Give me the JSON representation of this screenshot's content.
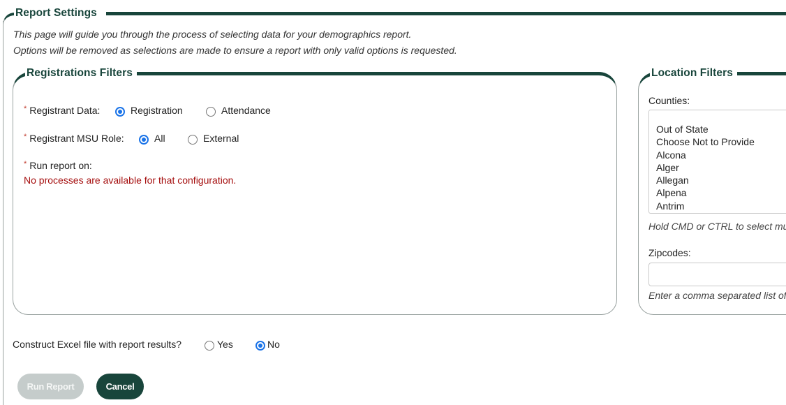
{
  "report_settings": {
    "legend": "Report Settings",
    "intro_line1": "This page will guide you through the process of selecting data for your demographics report.",
    "intro_line2": "Options will be removed as selections are made to ensure a report with only valid options is requested."
  },
  "registrations_filters": {
    "legend": "Registrations Filters",
    "required_marker": "*",
    "registrant_data": {
      "label": "Registrant Data:",
      "options": [
        {
          "label": "Registration",
          "checked": true
        },
        {
          "label": "Attendance",
          "checked": false
        }
      ]
    },
    "msu_role": {
      "label": "Registrant MSU Role:",
      "options": [
        {
          "label": "All",
          "checked": true
        },
        {
          "label": "External",
          "checked": false
        }
      ]
    },
    "run_report_on": {
      "label": "Run report on:",
      "error": "No processes are available for that configuration."
    }
  },
  "location_filters": {
    "legend": "Location Filters",
    "counties_label": "Counties:",
    "counties": [
      "",
      "Out of State",
      "Choose Not to Provide",
      "Alcona",
      "Alger",
      "Allegan",
      "Alpena",
      "Antrim"
    ],
    "counties_hint": "Hold CMD or CTRL to select multiple",
    "zipcodes_label": "Zipcodes:",
    "zipcodes_value": "",
    "zipcodes_hint": "Enter a comma separated list of zipcodes"
  },
  "excel": {
    "label": "Construct Excel file with report results?",
    "options": [
      {
        "label": "Yes",
        "checked": false
      },
      {
        "label": "No",
        "checked": true
      }
    ]
  },
  "buttons": {
    "run_report": "Run Report",
    "cancel": "Cancel"
  },
  "colors": {
    "brand_green": "#18453b",
    "error_red": "#a50e0e",
    "radio_blue": "#1a73e8"
  }
}
